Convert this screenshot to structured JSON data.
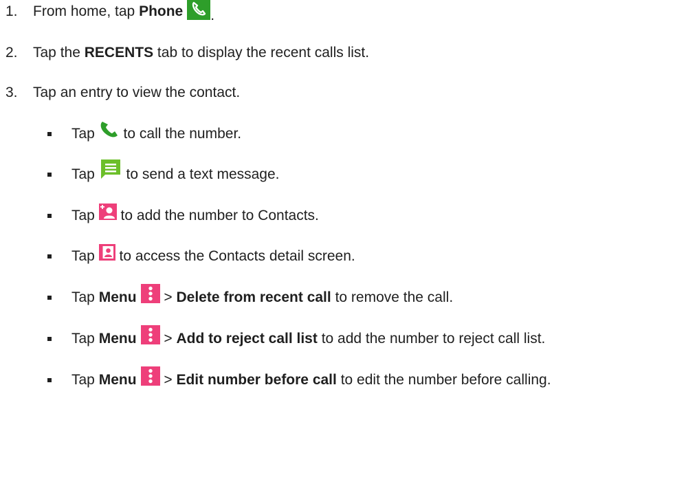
{
  "steps": [
    {
      "number": "1.",
      "pre": "From home, tap ",
      "bold": "Phone",
      "post": ".",
      "icon": "phone-app-icon"
    },
    {
      "number": "2.",
      "pre": "Tap the ",
      "bold": "RECENTS",
      "post": " tab to display the recent calls list."
    },
    {
      "number": "3.",
      "text": "Tap an entry to view the contact."
    }
  ],
  "bullets": [
    {
      "pre": "Tap ",
      "icon": "phone-call-icon",
      "post": " to call the number."
    },
    {
      "pre": "Tap ",
      "icon": "message-icon",
      "post": " to send a text message."
    },
    {
      "pre": "Tap ",
      "icon": "add-contact-icon",
      "post": " to add the number to Contacts."
    },
    {
      "pre": "Tap ",
      "icon": "contact-card-icon",
      "post": " to access the Contacts detail screen."
    },
    {
      "pre": "Tap ",
      "bold1": "Menu",
      "icon": "menu-icon",
      "sep": " > ",
      "bold2": "Delete from recent call",
      "post": " to remove the call."
    },
    {
      "pre": "Tap ",
      "bold1": "Menu",
      "icon": "menu-icon",
      "sep": " > ",
      "bold2": "Add to reject call list",
      "post": " to add the number to reject call list."
    },
    {
      "pre": "Tap ",
      "bold1": "Menu",
      "icon": "menu-icon",
      "sep": " > ",
      "bold2": "Edit number before call",
      "post": " to edit the number before calling."
    }
  ],
  "colors": {
    "green": "#2e9e2a",
    "message_green": "#6cbf2a",
    "pink": "#ee3f7a",
    "text": "#1f1f1f"
  }
}
